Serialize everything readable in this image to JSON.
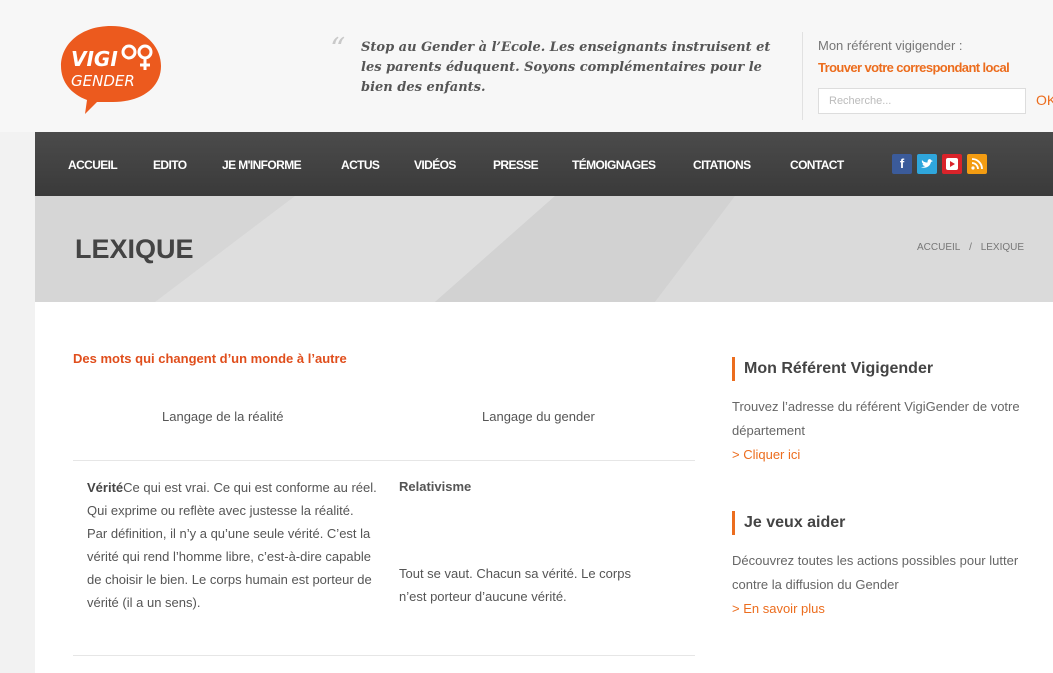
{
  "logo": {
    "word1": "VIGI",
    "word2": "GENDER"
  },
  "quote": "Stop au Gender à l’Ecole. Les enseignants instruisent et les parents éduquent. Soyons complémentaires pour le bien des enfants.",
  "referent": {
    "label": "Mon référent vigigender :",
    "link": "Trouver votre correspondant local"
  },
  "search": {
    "placeholder": "Recherche...",
    "ok": "OK"
  },
  "nav": {
    "items": [
      "ACCUEIL",
      "EDITO",
      "JE M'INFORME",
      "ACTUS",
      "VIDÉOS",
      "PRESSE",
      "TÉMOIGNAGES",
      "CITATIONS",
      "CONTACT"
    ],
    "social": [
      "facebook-icon",
      "twitter-icon",
      "youtube-icon",
      "rss-icon"
    ]
  },
  "page": {
    "title": "LEXIQUE",
    "breadcrumb": {
      "home": "ACCUEIL",
      "sep": "/",
      "current": "LEXIQUE"
    }
  },
  "content": {
    "section_title": "Des mots qui changent d’un monde à l’autre",
    "col_left": "Langage de la  réalité",
    "col_right": "Langage du gender",
    "rows": [
      {
        "term": "Vérité",
        "definition": "Ce qui est vrai. Ce qui est conforme au réel. Qui exprime ou reflète avec justesse la réalité. Par définition, il n’y a qu’une seule vérité. C’est la vérité qui rend l’homme libre, c’est-à-dire capable de choisir le bien. Le corps humain est porteur de vérité (il a un sens).",
        "gender_term": "Relativisme",
        "gender_definition": "Tout se vaut. Chacun sa vérité. Le corps  n’est porteur d’aucune vérité."
      }
    ]
  },
  "sidebar": {
    "blocks": [
      {
        "title": "Mon Référent Vigigender",
        "text": "Trouvez l’adresse du référent VigiGender de votre département",
        "link": "> Cliquer ici"
      },
      {
        "title": "Je veux aider",
        "text": "Découvrez toutes les actions possibles pour lutter contre la diffusion du Gender",
        "link": "> En savoir plus"
      }
    ]
  },
  "colors": {
    "accent": "#ec6d1e",
    "nav_bg": "#3f3f3f",
    "section_title": "#e04e1c"
  }
}
